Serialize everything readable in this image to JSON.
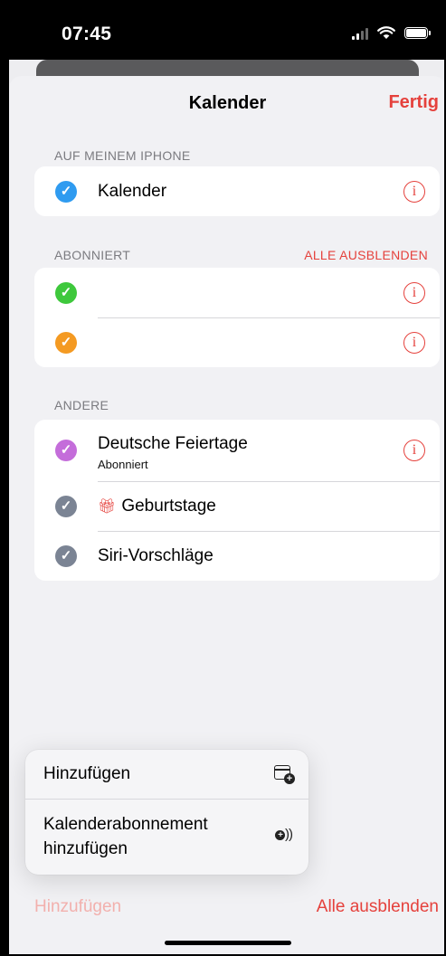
{
  "status_bar": {
    "time": "07:45",
    "icons": [
      "signal-icon",
      "wifi-icon",
      "battery-icon"
    ]
  },
  "nav": {
    "title": "Kalender",
    "done_label": "Fertig"
  },
  "sections": [
    {
      "header": "AUF MEINEM IPHONE",
      "action": "",
      "rows": [
        {
          "label": "Kalender",
          "subtitle": "",
          "color": "#2f9bf0",
          "checked": true,
          "info": true
        }
      ]
    },
    {
      "header": "ABONNIERT",
      "action": "ALLE AUSBLENDEN",
      "rows": [
        {
          "label": "",
          "subtitle": "",
          "color": "#3ec83c",
          "checked": true,
          "info": true
        },
        {
          "label": "",
          "subtitle": "",
          "color": "#f49a22",
          "checked": true,
          "info": true
        }
      ]
    },
    {
      "header": "ANDERE",
      "action": "",
      "rows": [
        {
          "label": "Deutsche Feiertage",
          "subtitle": "Abonniert",
          "color": "#c46dda",
          "checked": true,
          "info": true
        },
        {
          "label": "Geburtstage",
          "subtitle": "",
          "color": "#7b8494",
          "checked": true,
          "info": false,
          "icon": "gift-icon"
        },
        {
          "label": "Siri-Vorschläge",
          "subtitle": "",
          "color": "#7b8494",
          "checked": true,
          "info": false
        }
      ]
    }
  ],
  "popup_menu": {
    "items": [
      {
        "label": "Hinzufügen",
        "icon": "calendar-add-icon"
      },
      {
        "label": "Kalenderabonnement hinzufügen",
        "icon": "subscribe-broadcast-icon"
      }
    ]
  },
  "bottom_bar": {
    "left_label": "Hinzufügen",
    "right_label": "Alle ausblenden"
  },
  "colors": {
    "accent": "#e5413c",
    "background": "#f1f1f4"
  }
}
